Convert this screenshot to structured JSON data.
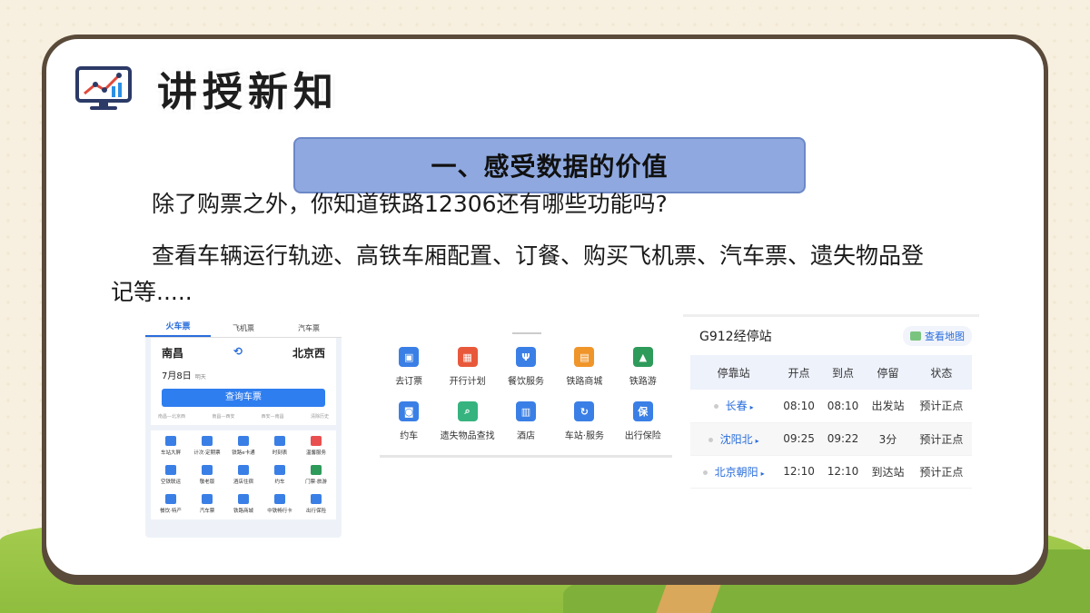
{
  "header": {
    "title": "讲授新知"
  },
  "section": {
    "title": "一、感受数据的价值"
  },
  "body": {
    "question": "除了购票之外，你知道铁路12306还有哪些功能吗?",
    "answer": "查看车辆运行轨迹、高铁车厢配置、订餐、购买飞机票、汽车票、遗失物品登记等....."
  },
  "phone": {
    "tabs": [
      {
        "label": "火车票",
        "active": true
      },
      {
        "label": "飞机票",
        "active": false
      },
      {
        "label": "汽车票",
        "active": false
      }
    ],
    "from": "南昌",
    "to": "北京西",
    "date": "7月8日",
    "date_note": "明天",
    "search_button": "查询车票",
    "history": [
      "南昌—北京西",
      "南昌—西安",
      "西安—南昌",
      "清除历史"
    ],
    "grid": [
      {
        "label": "车站大屏",
        "color": "#3a7fe6"
      },
      {
        "label": "计次·定期票",
        "color": "#3a7fe6"
      },
      {
        "label": "铁路e卡通",
        "color": "#3a7fe6"
      },
      {
        "label": "时刻表",
        "color": "#3a7fe6"
      },
      {
        "label": "温馨服务",
        "color": "#e94f4f"
      },
      {
        "label": "空铁联运",
        "color": "#3a7fe6"
      },
      {
        "label": "敬老版",
        "color": "#3a7fe6"
      },
      {
        "label": "酒店住宿",
        "color": "#3a7fe6"
      },
      {
        "label": "约车",
        "color": "#3a7fe6"
      },
      {
        "label": "门票·旅游",
        "color": "#2e9b5a"
      },
      {
        "label": "餐饮·特产",
        "color": "#3a7fe6"
      },
      {
        "label": "汽车票",
        "color": "#3a7fe6"
      },
      {
        "label": "铁路商城",
        "color": "#3a7fe6"
      },
      {
        "label": "中铁畅行卡",
        "color": "#3a7fe6"
      },
      {
        "label": "出行保险",
        "color": "#3a7fe6"
      }
    ]
  },
  "services": [
    {
      "label": "去订票",
      "icon": "train-icon",
      "color": "#3a7fe6",
      "glyph": "▣"
    },
    {
      "label": "开行计划",
      "icon": "calendar-icon",
      "color": "#e8593b",
      "glyph": "▦"
    },
    {
      "label": "餐饮服务",
      "icon": "fork-knife-icon",
      "color": "#3a7fe6",
      "glyph": "Ψ"
    },
    {
      "label": "铁路商城",
      "icon": "shop-icon",
      "color": "#f0952a",
      "glyph": "▤"
    },
    {
      "label": "铁路游",
      "icon": "mountain-icon",
      "color": "#2e9b5a",
      "glyph": "▲"
    },
    {
      "label": "约车",
      "icon": "car-icon",
      "color": "#3a7fe6",
      "glyph": "◙"
    },
    {
      "label": "遗失物品查找",
      "icon": "lost-item-icon",
      "color": "#36b37e",
      "glyph": "⌕"
    },
    {
      "label": "酒店",
      "icon": "hotel-icon",
      "color": "#3a7fe6",
      "glyph": "▥"
    },
    {
      "label": "车站·服务",
      "icon": "station-service-icon",
      "color": "#3a7fe6",
      "glyph": "↻"
    },
    {
      "label": "出行保险",
      "icon": "insurance-icon",
      "color": "#3a7fe6",
      "glyph": "保"
    }
  ],
  "stops": {
    "title": "G912经停站",
    "map_button": "查看地图",
    "columns": [
      "停靠站",
      "开点",
      "到点",
      "停留",
      "状态"
    ],
    "rows": [
      [
        "长春",
        "08:10",
        "08:10",
        "出发站",
        "预计正点"
      ],
      [
        "沈阳北",
        "09:25",
        "09:22",
        "3分",
        "预计正点"
      ],
      [
        "北京朝阳",
        "12:10",
        "12:10",
        "到达站",
        "预计正点"
      ]
    ]
  }
}
